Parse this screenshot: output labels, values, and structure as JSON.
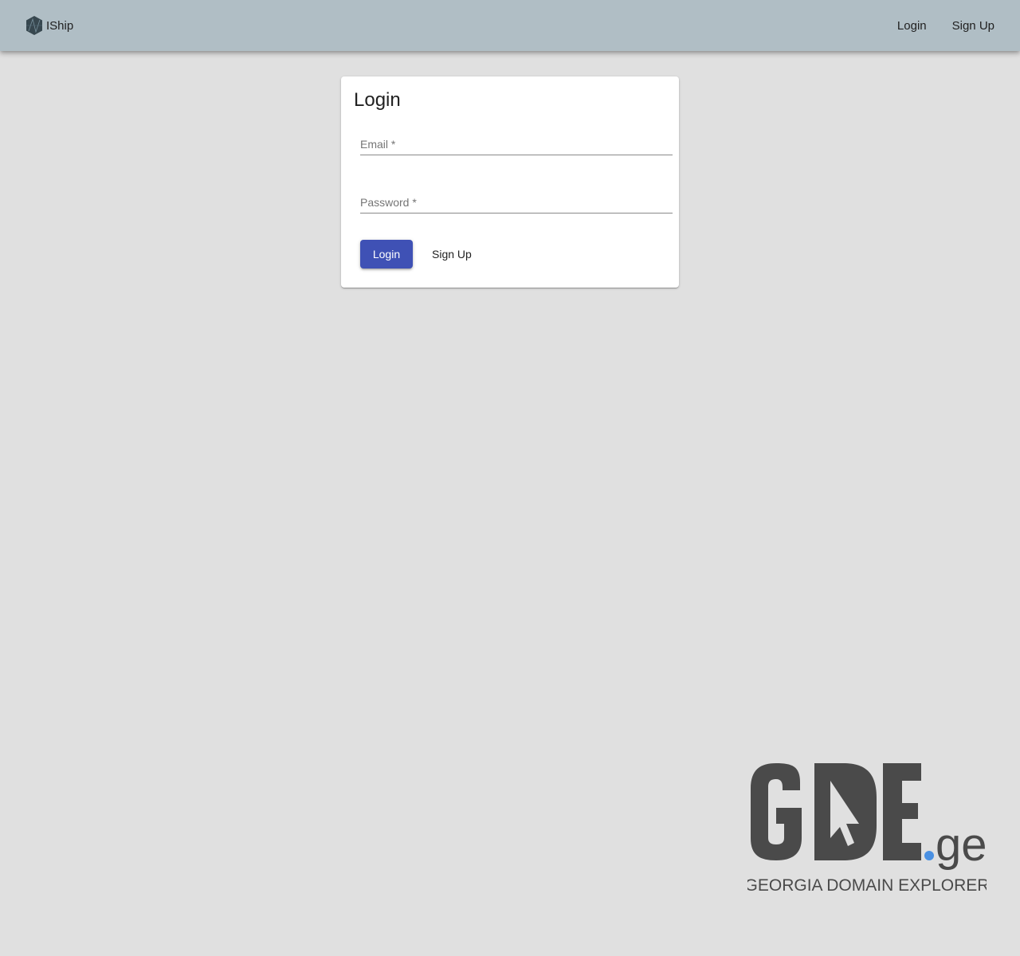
{
  "app": {
    "name": "IShip",
    "logo_icon": "hexagon-logo-icon"
  },
  "nav": {
    "login_label": "Login",
    "signup_label": "Sign Up"
  },
  "login_card": {
    "title": "Login",
    "email_label": "Email *",
    "email_value": "",
    "password_label": "Password *",
    "password_value": "",
    "login_button": "Login",
    "signup_button": "Sign Up"
  },
  "watermark": {
    "brand": "GDE.ge",
    "tagline": "GEORGIA DOMAIN EXPLORER"
  },
  "colors": {
    "appbar": "#b0bec5",
    "background": "#e0e0e0",
    "primary_button": "#3f51b5",
    "watermark_gray": "#4a4a4a",
    "watermark_dot": "#4a90e2"
  }
}
